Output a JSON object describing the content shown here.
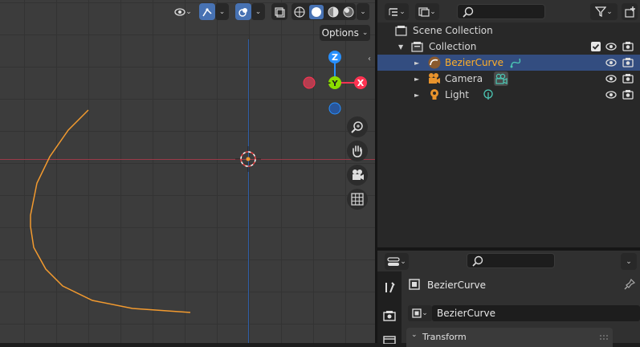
{
  "viewport": {
    "options_label": "Options",
    "colors": {
      "curve": "#f29a2f",
      "x_axis": "#ff3352",
      "y_axis": "#8bdc00",
      "z_axis": "#2890ff"
    },
    "gizmo": {
      "z_label": "Z",
      "y_label": "Y",
      "x_label": "X"
    },
    "header_icons": [
      "visibility-icon",
      "transform-gizmo-icon",
      "overlay-icon",
      "xray-icon",
      "shading-wireframe-icon",
      "shading-solid-icon",
      "shading-material-icon",
      "shading-rendered-icon"
    ],
    "nav_icons": [
      "zoom-icon",
      "hand-icon",
      "camera-icon",
      "grid-icon"
    ]
  },
  "outliner": {
    "header_icons": [
      "display-mode-icon",
      "filter-icon",
      "new-collection-icon"
    ],
    "rows": [
      {
        "label": "Scene Collection",
        "icon": "scene-collection-icon"
      },
      {
        "label": "Collection",
        "icon": "collection-icon",
        "checked": true
      },
      {
        "label": "BezierCurve",
        "icon": "curve-object-icon",
        "selected": true,
        "data_icon": "curve-data-icon"
      },
      {
        "label": "Camera",
        "icon": "camera-object-icon",
        "data_icon": "camera-data-icon"
      },
      {
        "label": "Light",
        "icon": "light-object-icon",
        "data_icon": "light-data-icon"
      }
    ],
    "colors": {
      "selected_row": "#334d80",
      "selected_text": "#ffaf29",
      "data_icon": "#4cc7b4"
    }
  },
  "properties": {
    "object_name": "BezierCurve",
    "data_name": "BezierCurve",
    "panel_title": "Transform",
    "tabs": [
      "tool-icon",
      "render-icon",
      "output-icon"
    ]
  }
}
